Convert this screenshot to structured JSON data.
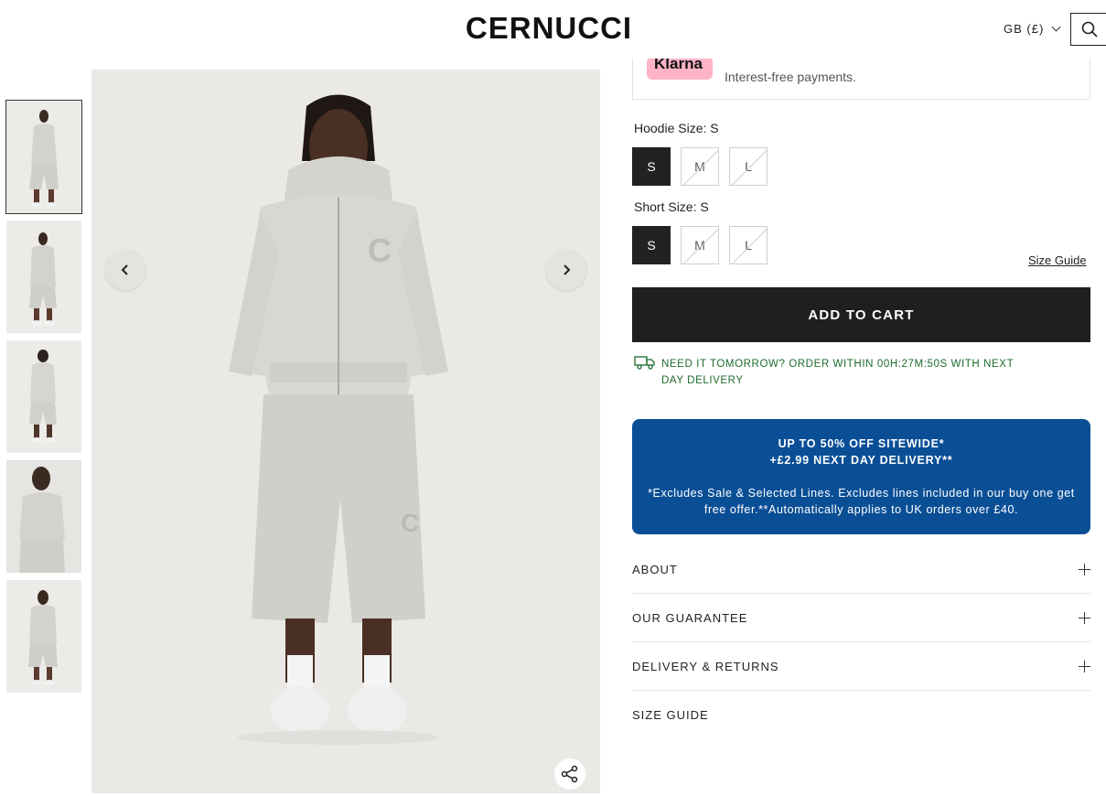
{
  "header": {
    "logo_text": "CERNUCCI",
    "currency_label": "GB (£)",
    "search_icon": "search-icon"
  },
  "gallery": {
    "thumbnails": [
      {
        "alt": "Product view 1",
        "active": true
      },
      {
        "alt": "Product view 2",
        "active": false
      },
      {
        "alt": "Product view 3",
        "active": false
      },
      {
        "alt": "Product view 4",
        "active": false
      },
      {
        "alt": "Product view 5",
        "active": false
      }
    ],
    "prev_icon": "chevron-left-icon",
    "next_icon": "chevron-right-icon",
    "share_icon": "share-icon"
  },
  "klarna": {
    "logo_text": "Klarna",
    "text": "Interest-free payments."
  },
  "hoodie_size": {
    "label": "Hoodie Size: S",
    "options": [
      {
        "label": "S",
        "selected": true,
        "available": true
      },
      {
        "label": "M",
        "selected": false,
        "available": false
      },
      {
        "label": "L",
        "selected": false,
        "available": false
      }
    ]
  },
  "short_size": {
    "label": "Short Size: S",
    "options": [
      {
        "label": "S",
        "selected": true,
        "available": true
      },
      {
        "label": "M",
        "selected": false,
        "available": false
      },
      {
        "label": "L",
        "selected": false,
        "available": false
      }
    ]
  },
  "size_guide_link": "Size Guide",
  "add_to_cart": "ADD TO CART",
  "delivery": {
    "icon": "truck-icon",
    "text": "NEED IT TOMORROW? ORDER WITHIN 00H:27M:50S WITH NEXT DAY DELIVERY",
    "color": "#1d6b2b"
  },
  "promo": {
    "line1": "UP TO 50% OFF SITEWIDE*",
    "line2": "+£2.99 NEXT DAY DELIVERY**",
    "line3": "*Excludes Sale & Selected Lines. Excludes lines included in our buy one get free offer.**Automatically applies to UK orders over £40.",
    "background": "#0a4f96"
  },
  "accordion": [
    {
      "label": "ABOUT"
    },
    {
      "label": "OUR GUARANTEE"
    },
    {
      "label": "DELIVERY & RETURNS"
    },
    {
      "label": "SIZE GUIDE"
    }
  ]
}
